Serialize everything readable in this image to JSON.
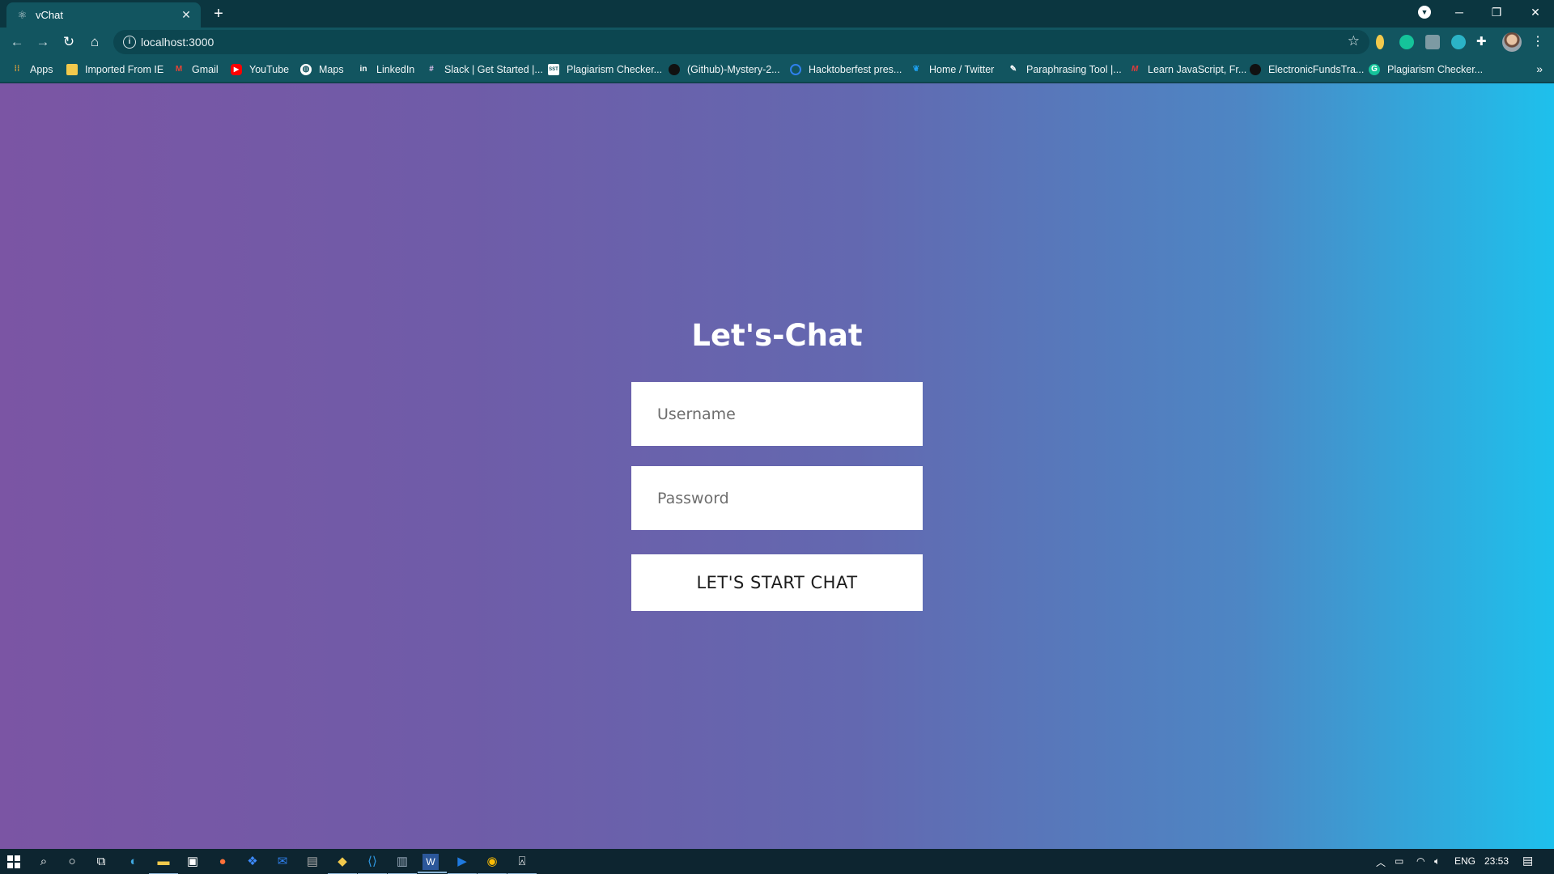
{
  "browser": {
    "tab_title": "vChat",
    "tab_close": "✕",
    "new_tab": "+",
    "url": "localhost:3000"
  },
  "bookmarks": [
    {
      "label": "Apps",
      "icon": "apps-grid-icon",
      "color": "#e8a33a"
    },
    {
      "label": "Imported From IE",
      "icon": "folder-icon",
      "color": "#f2c94c"
    },
    {
      "label": "Gmail",
      "icon": "gmail-icon",
      "color": "#ea4335"
    },
    {
      "label": "YouTube",
      "icon": "youtube-icon",
      "color": "#ff0000"
    },
    {
      "label": "Maps",
      "icon": "globe-icon",
      "color": "#ffffff"
    },
    {
      "label": "LinkedIn",
      "icon": "linkedin-icon",
      "color": "#0a66c2"
    },
    {
      "label": "Slack | Get Started |...",
      "icon": "slack-icon",
      "color": "#611f69"
    },
    {
      "label": "Plagiarism Checker...",
      "icon": "sst-icon",
      "color": "#ffffff"
    },
    {
      "label": "(Github)-Mystery-2...",
      "icon": "github-icon",
      "color": "#111111"
    },
    {
      "label": "Hacktoberfest pres...",
      "icon": "hacktoberfest-icon",
      "color": "#2f80ed"
    },
    {
      "label": "Home / Twitter",
      "icon": "twitter-icon",
      "color": "#1da1f2"
    },
    {
      "label": "Paraphrasing Tool |...",
      "icon": "feather-icon",
      "color": "#ffffff"
    },
    {
      "label": "Learn JavaScript, Fr...",
      "icon": "codecademy-icon",
      "color": "#e23b3b"
    },
    {
      "label": "ElectronicFundsTra...",
      "icon": "github-icon",
      "color": "#111111"
    },
    {
      "label": "Plagiarism Checker...",
      "icon": "grammarly-icon",
      "color": "#15c39a"
    }
  ],
  "main": {
    "heading": "Let's-Chat",
    "username_placeholder": "Username",
    "password_placeholder": "Password",
    "start_button": "LET'S START CHAT"
  },
  "taskbar": {
    "language": "ENG",
    "time": "23:53"
  }
}
